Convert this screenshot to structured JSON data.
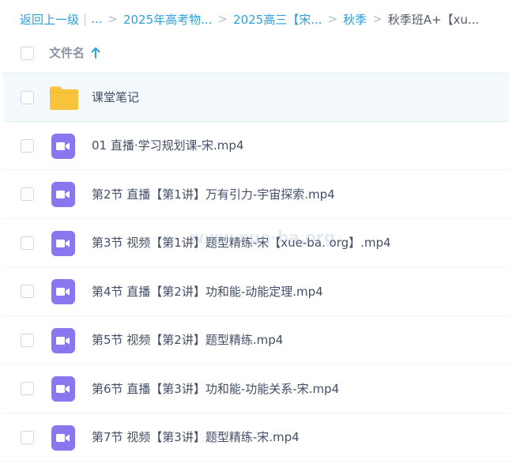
{
  "breadcrumb": {
    "back": "返回上一级",
    "ellipsis": "...",
    "items": [
      "2025年高考物...",
      "2025高三【宋...",
      "秋季"
    ],
    "current": "秋季班A+【xu..."
  },
  "header": {
    "column_name": "文件名",
    "sort": "ascending"
  },
  "files": [
    {
      "name": "课堂笔记",
      "type": "folder",
      "selected": true
    },
    {
      "name": "01 直播·学习规划课-宋.mp4",
      "type": "video"
    },
    {
      "name": "第2节 直播【第1讲】万有引力-宇宙探索.mp4",
      "type": "video"
    },
    {
      "name": "第3节 视频【第1讲】题型精练-宋【xue-ba. org】.mp4",
      "type": "video"
    },
    {
      "name": "第4节 直播【第2讲】功和能-动能定理.mp4",
      "type": "video"
    },
    {
      "name": "第5节 视频【第2讲】题型精练.mp4",
      "type": "video"
    },
    {
      "name": "第6节 直播【第3讲】功和能-功能关系-宋.mp4",
      "type": "video"
    },
    {
      "name": "第7节 视频【第3讲】题型精练-宋.mp4",
      "type": "video"
    }
  ],
  "watermark": "www.xue-ba.org",
  "colors": {
    "link": "#2e9fd9",
    "folder": "#f9c33c",
    "video": "#8877ee",
    "selected_row": "#f3f9fd"
  }
}
